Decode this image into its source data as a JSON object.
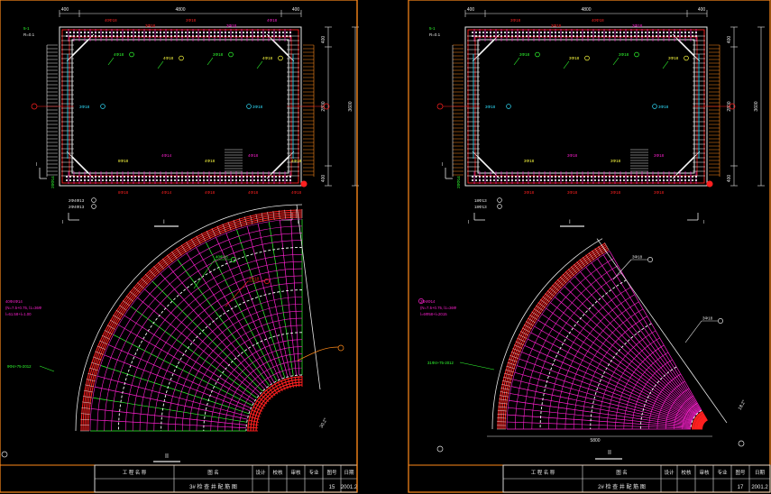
{
  "colors": {
    "frame": "#ff8a1a",
    "rebar_red": "#ff2020",
    "rebar_magenta": "#ff20d0",
    "rebar_green": "#30ff30",
    "rebar_white": "#ffffff",
    "rebar_cyan": "#30e0ff",
    "dim_yellow": "#ffff40",
    "outline_white": "#e8e8e8"
  },
  "sheets": [
    {
      "plan": {
        "top_dims": [
          "400",
          "4800",
          "400"
        ],
        "right_dims": [
          "400",
          "2800",
          "400"
        ],
        "right_total": "3600",
        "top_callouts": [
          "40Φ18",
          "3Φ18",
          "3Φ18",
          "3Φ18",
          "4Φ18"
        ],
        "right_callout": "3Φ18",
        "inner_callouts": [
          "4Φ18",
          "4Φ18",
          "3Φ18",
          "4Φ18"
        ],
        "side_callouts": [
          "3Φ18",
          "3Φ18"
        ],
        "bottom_callouts": [
          "8Φ18",
          "4Φ14",
          "4Φ18",
          "4Φ18",
          "4Φ18"
        ],
        "left_note": "R=0.1",
        "left_note2": "5-1",
        "section_marks": [
          "I",
          "I",
          "I",
          "I"
        ],
        "left_vertical": "20Φ14",
        "bottom_notes": [
          "2Φ4Φ13",
          "2Φ4Φ13"
        ]
      },
      "fan": {
        "callouts": [
          "40Φ18",
          "4Φ18"
        ],
        "note_lines": [
          "40Φ4Φ14",
          "(N=7.5+0.75, l1=36Φ",
          "l=61.58+l=1.00"
        ],
        "left_note": "9Φ4+75-2012",
        "angle": "30.2°",
        "section_label": "II"
      },
      "title_block": {
        "cells": [
          "工  程  名  称",
          "图    名",
          "设计",
          "校核",
          "审核",
          "专业",
          "图号",
          "日期"
        ],
        "drawing_name": "3# 检 查 井 配 筋 图",
        "sheet_no": "15",
        "date": "2001.2"
      }
    },
    {
      "plan": {
        "top_dims": [
          "400",
          "4800",
          "400"
        ],
        "right_dims": [
          "400",
          "2800",
          "400"
        ],
        "right_total": "3600",
        "top_callouts": [
          "3Φ18",
          "3Φ18",
          "40Φ18",
          "3Φ18"
        ],
        "right_callout": "3Φ18",
        "inner_callouts": [
          "3Φ18",
          "3Φ18",
          "3Φ18",
          "3Φ18"
        ],
        "side_callouts": [
          "3Φ18",
          "3Φ18"
        ],
        "bottom_callouts": [
          "3Φ18",
          "3Φ18",
          "3Φ18",
          "3Φ18"
        ],
        "left_note": "R=0.1",
        "left_note2": "5-1",
        "section_marks": [
          "I",
          "I",
          "I",
          "I"
        ],
        "left_vertical": "20Φ14",
        "bottom_notes": [
          "18Φ13",
          "18Φ13"
        ]
      },
      "fan": {
        "callouts": [
          "3Φ18",
          "3Φ18"
        ],
        "note_lines": [
          "2Φ4Φ14",
          "(N=7.5+0.75, l1=36Φ",
          "l=6Φ58+l=2015"
        ],
        "left_note": "31Φ4+75-2012",
        "angle": "18.2°",
        "bottom_dim": "5800",
        "section_label": "II"
      },
      "title_block": {
        "cells": [
          "工  程  名  称",
          "图    名",
          "设计",
          "校核",
          "审核",
          "专业",
          "图号",
          "日期"
        ],
        "drawing_name": "2# 检 查 井 配 筋 图",
        "sheet_no": "17",
        "date": "2001.2"
      }
    }
  ]
}
